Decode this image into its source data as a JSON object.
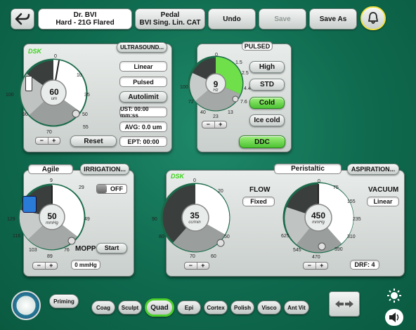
{
  "header": {
    "surgeon_line1": "Dr. BVI",
    "surgeon_line2": "Hard - 21G Flared",
    "pedal_line1": "Pedal",
    "pedal_line2": "BVI Sing. Lin. CAT",
    "undo": "Undo",
    "save": "Save",
    "save_as": "Save As"
  },
  "ultrasound": {
    "dsk": "DSK",
    "title": "ULTRASOUND...",
    "mode": "Linear",
    "pulse": "Pulsed",
    "autolimit": "Autolimit",
    "ust": "UST: 00:00 mm:ss",
    "avg": "AVG: 0.0 um",
    "ept": "EPT: 00:00",
    "reset": "Reset",
    "value": "60",
    "unit": "um",
    "ticks": [
      "0",
      "10",
      "35",
      "50",
      "55",
      "70",
      "90",
      "100"
    ]
  },
  "pulsed": {
    "title": "PULSED",
    "high": "High",
    "std": "STD",
    "cold": "Cold",
    "ice_cold": "Ice cold",
    "ddc": "DDC",
    "value": "9",
    "unit": "Hz",
    "ticks": [
      "0",
      "1.5",
      "2.5",
      "4.4",
      "7.6",
      "13",
      "23",
      "40",
      "72",
      "100"
    ]
  },
  "irrigation": {
    "mode": "Agile",
    "title": "IRRIGATION...",
    "toggle": "OFF",
    "mopp": "MOPP",
    "start": "Start",
    "mopp_value": "0 mmHg",
    "value": "50",
    "unit": "mmHg",
    "ticks": [
      "9",
      "29",
      "49",
      "76",
      "89",
      "103",
      "116",
      "129"
    ]
  },
  "aspiration": {
    "dsk": "DSK",
    "pump": "Peristaltic",
    "title": "ASPIRATION...",
    "flow_label": "FLOW",
    "flow_mode": "Fixed",
    "vacuum_label": "VACUUM",
    "vacuum_mode": "Linear",
    "drf": "DRF: 4",
    "flow_value": "35",
    "flow_unit": "cc/min",
    "vac_value": "450",
    "vac_unit": "mmHg",
    "flow_ticks": [
      "0",
      "20",
      "50",
      "60",
      "70",
      "80",
      "90"
    ],
    "vac_ticks": [
      "0",
      "75",
      "155",
      "235",
      "310",
      "390",
      "470",
      "545",
      "625"
    ]
  },
  "footer": {
    "priming": "Priming",
    "modes": [
      "Coag",
      "Sculpt",
      "Quad",
      "Epi",
      "Cortex",
      "Polish",
      "Visco",
      "Ant Vit"
    ],
    "selected": "Quad"
  }
}
